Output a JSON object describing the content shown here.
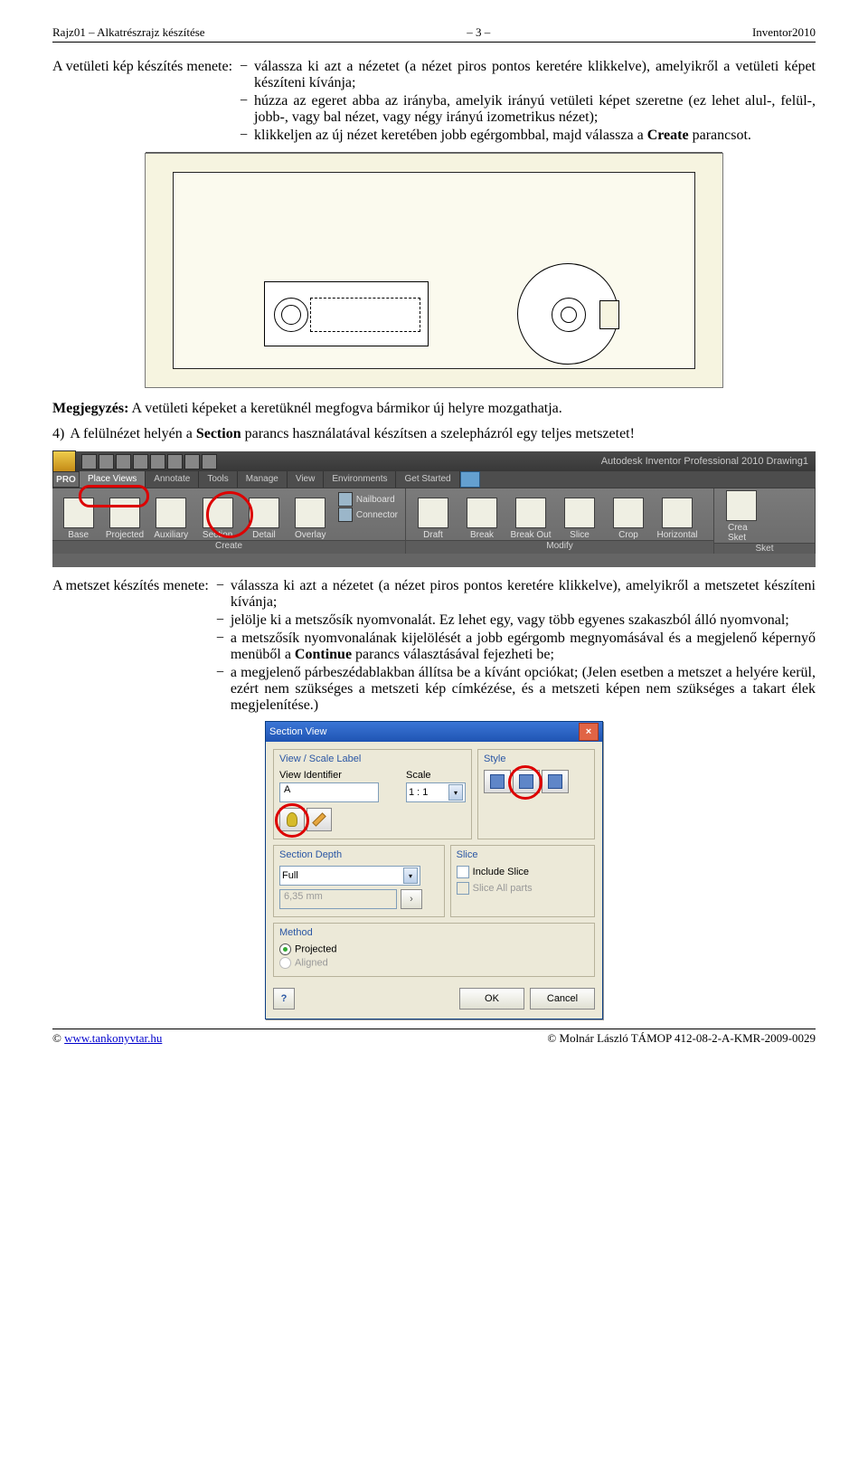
{
  "header": {
    "left": "Rajz01 – Alkatrészrajz készítése",
    "center": "– 3 –",
    "right": "Inventor2010"
  },
  "section1": {
    "label": "A vetületi kép készítés menete:",
    "bullets": [
      "válassza ki azt a nézetet (a nézet piros pontos keretére klikkelve), amelyikről a vetületi képet készíteni kívánja;",
      "húzza az egeret abba az irányba, amelyik irányú vetületi képet szeretne (ez lehet alul-, felül-, jobb-, vagy bal nézet, vagy négy irányú izometrikus nézet);",
      "klikkeljen az új nézet keretében jobb egérgombbal, majd válassza a Create parancsot."
    ],
    "create_word": "Create"
  },
  "note": {
    "label": "Megjegyzés:",
    "text": "A vetületi képeket a keretüknél megfogva bármikor új helyre mozgathatja."
  },
  "step4": {
    "num": "4)",
    "text_before": "A felülnézet helyén a ",
    "section_word": "Section",
    "text_after": " parancs használatával készítsen a szelepházról egy teljes metszetet!"
  },
  "ribbon": {
    "title": "Autodesk Inventor Professional 2010   Drawing1",
    "pro": "PRO",
    "tabs": [
      "Place Views",
      "Annotate",
      "Tools",
      "Manage",
      "View",
      "Environments",
      "Get Started"
    ],
    "group_create_items": [
      "Base",
      "Projected",
      "Auxiliary",
      "Section",
      "Detail",
      "Overlay"
    ],
    "group_small": [
      "Nailboard",
      "Connector"
    ],
    "group_modify_items": [
      "Draft",
      "Break",
      "Break Out",
      "Slice",
      "Crop",
      "Horizontal"
    ],
    "group_sketch_items": [
      "Crea Sket"
    ],
    "group_sketch_sub": "Sket",
    "group_names": [
      "Create",
      "Modify"
    ]
  },
  "section2": {
    "label": "A metszet készítés menete:",
    "bullets": [
      "válassza ki azt a nézetet (a nézet piros pontos keretére klikkelve), amelyikről a metszetet készíteni kívánja;",
      "jelölje ki a metszősík nyomvonalát. Ez lehet egy, vagy több egyenes szakaszból álló nyomvonal;",
      "a metszősík nyomvonalának kijelölését a jobb egérgomb megnyomásával és a megjelenő képernyő menüből a Continue parancs választásával fejezheti be;",
      "a megjelenő párbeszédablakban állítsa be a kívánt opciókat; (Jelen esetben a metszet a helyére kerül, ezért nem szükséges a metszeti kép címkézése, és a metszeti képen nem szükséges a takart élek megjelenítése.)"
    ],
    "continue_word": "Continue"
  },
  "dialog": {
    "title": "Section View",
    "box1_title": "View / Scale Label",
    "view_id_label": "View Identifier",
    "view_id_value": "A",
    "scale_label": "Scale",
    "scale_value": "1 : 1",
    "box_style_title": "Style",
    "box_depth_title": "Section Depth",
    "depth_value": "Full",
    "depth_dim": "6,35 mm",
    "box_slice_title": "Slice",
    "include_slice": "Include Slice",
    "slice_all": "Slice All parts",
    "box_method_title": "Method",
    "projected": "Projected",
    "aligned": "Aligned",
    "ok": "OK",
    "cancel": "Cancel"
  },
  "footer": {
    "left_sym": "©",
    "left_link": "www.tankonyvtar.hu",
    "right": "© Molnár László TÁMOP 412-08-2-A-KMR-2009-0029"
  }
}
